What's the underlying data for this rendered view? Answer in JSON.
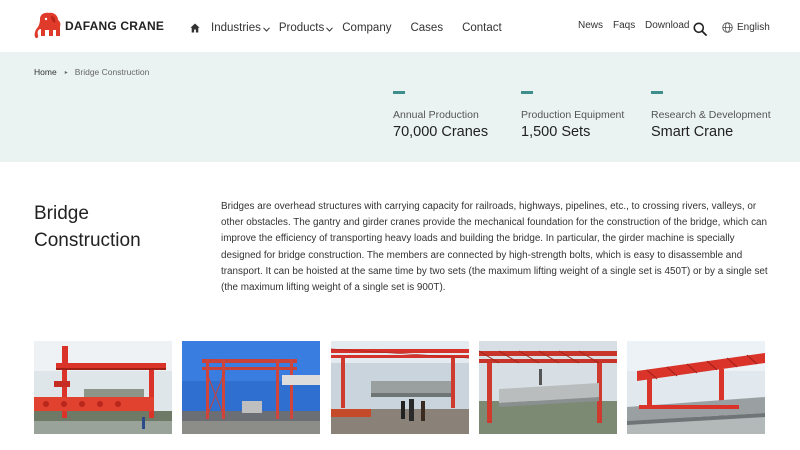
{
  "header": {
    "brand": "DAFANG CRANE",
    "nav": {
      "industries": "Industries",
      "products": "Products",
      "company": "Company",
      "cases": "Cases",
      "contact": "Contact"
    },
    "utility": {
      "news": "News",
      "faqs": "Faqs",
      "download": "Download",
      "language": "English"
    },
    "icons": [
      "elephant-logo-icon",
      "home-icon",
      "chevron-down-icon",
      "search-icon",
      "globe-icon"
    ]
  },
  "breadcrumb": {
    "home": "Home",
    "separator": "▸",
    "current": "Bridge Construction"
  },
  "stats": [
    {
      "label": "Annual Production",
      "value": "70,000 Cranes"
    },
    {
      "label": "Production Equipment",
      "value": "1,500 Sets"
    },
    {
      "label": "Research & Development",
      "value": "Smart Crane"
    }
  ],
  "main": {
    "title_line1": "Bridge",
    "title_line2": "Construction",
    "description": "Bridges are overhead structures with carrying capacity for railroads, highways, pipelines, etc., to crossing rivers, valleys, or other obstacles. The gantry and girder cranes provide the mechanical foundation for the construction of the bridge, which can improve the efficiency of transporting heavy loads and building the bridge. In particular, the girder machine is specially designed for bridge construction. The members are connected by high-strength bolts, which is easy to disassemble and transport. It can be hoisted at the same time by two sets (the maximum lifting weight of a single set is 450T) or by a single set (the maximum lifting weight of a single set is 900T)."
  },
  "colors": {
    "accent": "#3e8f8c",
    "banner_bg": "#eaf2f2",
    "brand_red": "#e03a2a",
    "crane_red": "#d9332a"
  }
}
